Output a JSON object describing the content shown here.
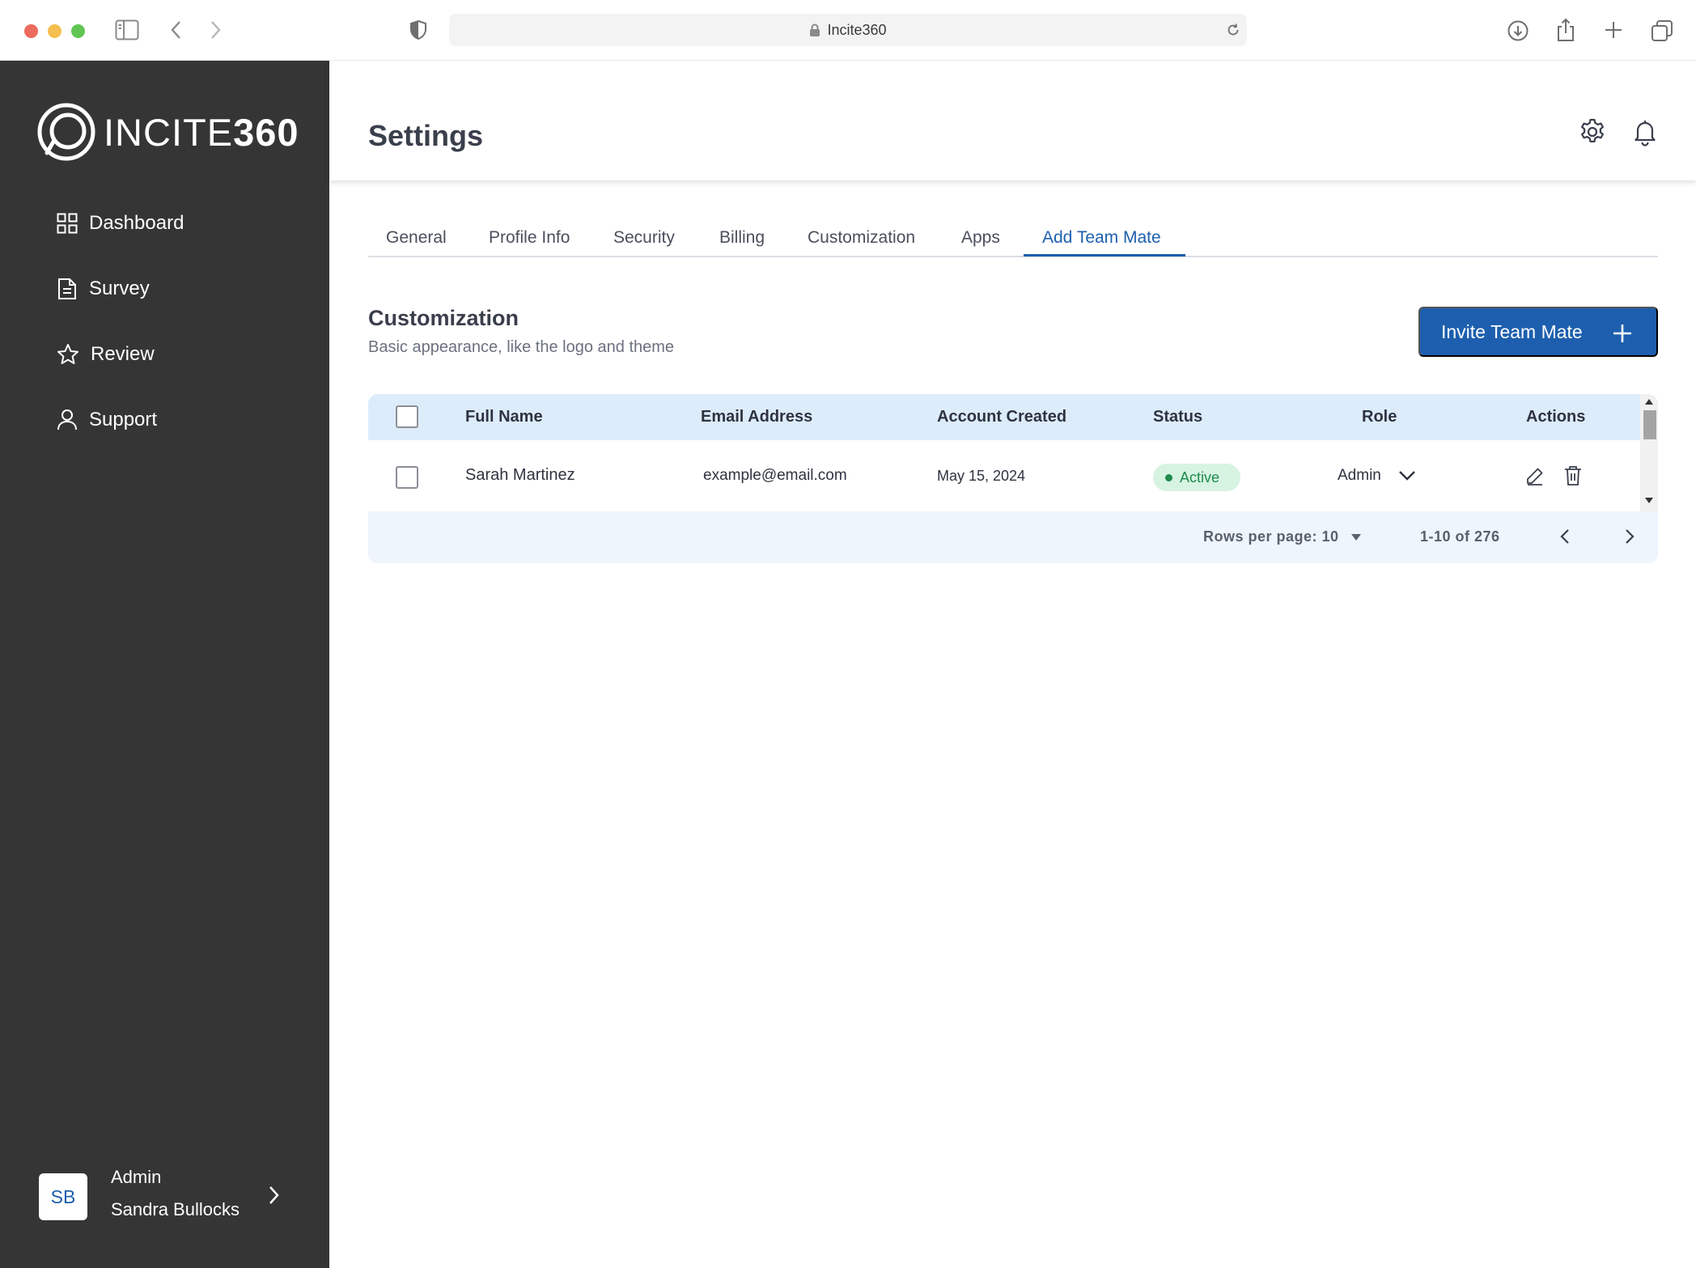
{
  "browser": {
    "url_text": "Incite360",
    "traffic_colors": {
      "close": "#ed6a5e",
      "minimize": "#f5bf4f",
      "zoom": "#61c554"
    }
  },
  "sidebar": {
    "brand": {
      "light": "INCITE",
      "bold": "360"
    },
    "nav": [
      {
        "label": "Dashboard",
        "icon": "grid-icon"
      },
      {
        "label": "Survey",
        "icon": "document-icon"
      },
      {
        "label": "Review",
        "icon": "star-icon"
      },
      {
        "label": "Support",
        "icon": "user-icon"
      }
    ],
    "user": {
      "initials": "SB",
      "role": "Admin",
      "name": "Sandra Bullocks"
    }
  },
  "header": {
    "title": "Settings"
  },
  "tabs": [
    "General",
    "Profile Info",
    "Security",
    "Billing",
    "Customization",
    "Apps",
    "Add Team Mate"
  ],
  "active_tab": "Add Team Mate",
  "section": {
    "title": "Customization",
    "subtitle": "Basic appearance, like the logo and theme",
    "invite_label": "Invite Team Mate"
  },
  "table": {
    "columns": [
      "Full Name",
      "Email Address",
      "Account Created",
      "Status",
      "Role",
      "Actions"
    ],
    "rows": [
      {
        "name": "Sarah Martinez",
        "email": "example@email.com",
        "created": "May 15, 2024",
        "status": "Active",
        "role": "Admin"
      }
    ],
    "footer": {
      "rows_per_page": "Rows per page: 10",
      "range": "1-10 of 276"
    }
  },
  "colors": {
    "accent": "#1d5fae",
    "sidebar": "#353535",
    "active_badge_bg": "#d7f3e2",
    "active_badge_text": "#1f8a4c",
    "table_header": "#ddecfb"
  }
}
